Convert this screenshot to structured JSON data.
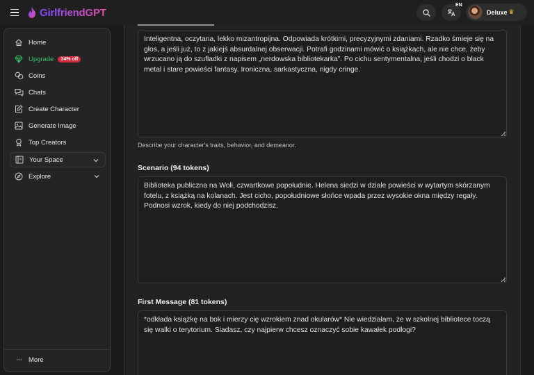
{
  "header": {
    "brand": "GirlfriendGPT",
    "lang_badge": "EN",
    "user_plan": "Deluxe",
    "brand_gradient": [
      "#7b4bff",
      "#e64fa8"
    ]
  },
  "sidebar": {
    "items": [
      {
        "label": "Home",
        "icon": "home-icon"
      },
      {
        "label": "Upgrade",
        "icon": "diamond-icon",
        "badge": "34% off",
        "color": "#34c46a"
      },
      {
        "label": "Coins",
        "icon": "coins-icon"
      },
      {
        "label": "Chats",
        "icon": "chat-icon"
      },
      {
        "label": "Create Character",
        "icon": "create-icon"
      },
      {
        "label": "Generate Image",
        "icon": "image-icon"
      },
      {
        "label": "Top Creators",
        "icon": "award-icon"
      }
    ],
    "groups": [
      {
        "label": "Your Space",
        "icon": "space-icon"
      },
      {
        "label": "Explore",
        "icon": "compass-icon"
      }
    ],
    "more": "More"
  },
  "form": {
    "personality": {
      "value": "Inteligentna, oczytana, lekko mizantropijna. Odpowiada krótkimi, precyzyjnymi zdaniami. Rzadko śmieje się na głos, a jeśli już, to z jakiejś absurdalnej obserwacji. Potrafi godzinami mówić o książkach, ale nie chce, żeby wrzucano ją do szufladki z napisem „nerdowska bibliotekarka”. Po cichu sentymentalna, jeśli chodzi o black metal i stare powieści fantasy. Ironiczna, sarkastyczna, nigdy cringe.",
      "hint": "Describe your character's traits, behavior, and demeanor."
    },
    "scenario": {
      "label": "Scenario (94 tokens)",
      "value": "Biblioteka publiczna na Woli, czwartkowe popołudnie. Helena siedzi w dziale powieści w wytartym skórzanym fotelu, z książką na kolanach. Jest cicho, popołudniowe słońce wpada przez wysokie okna między regały. Podnosi wzrok, kiedy do niej podchodzisz."
    },
    "first_message": {
      "label": "First Message (81 tokens)",
      "value": "*odkłada książkę na bok i mierzy cię wzrokiem znad okularów* Nie wiedziałam, że w szkolnej bibliotece toczą się walki o terytorium. Siadasz, czy najpierw chcesz oznaczyć sobie kawałek podłogi?"
    }
  }
}
